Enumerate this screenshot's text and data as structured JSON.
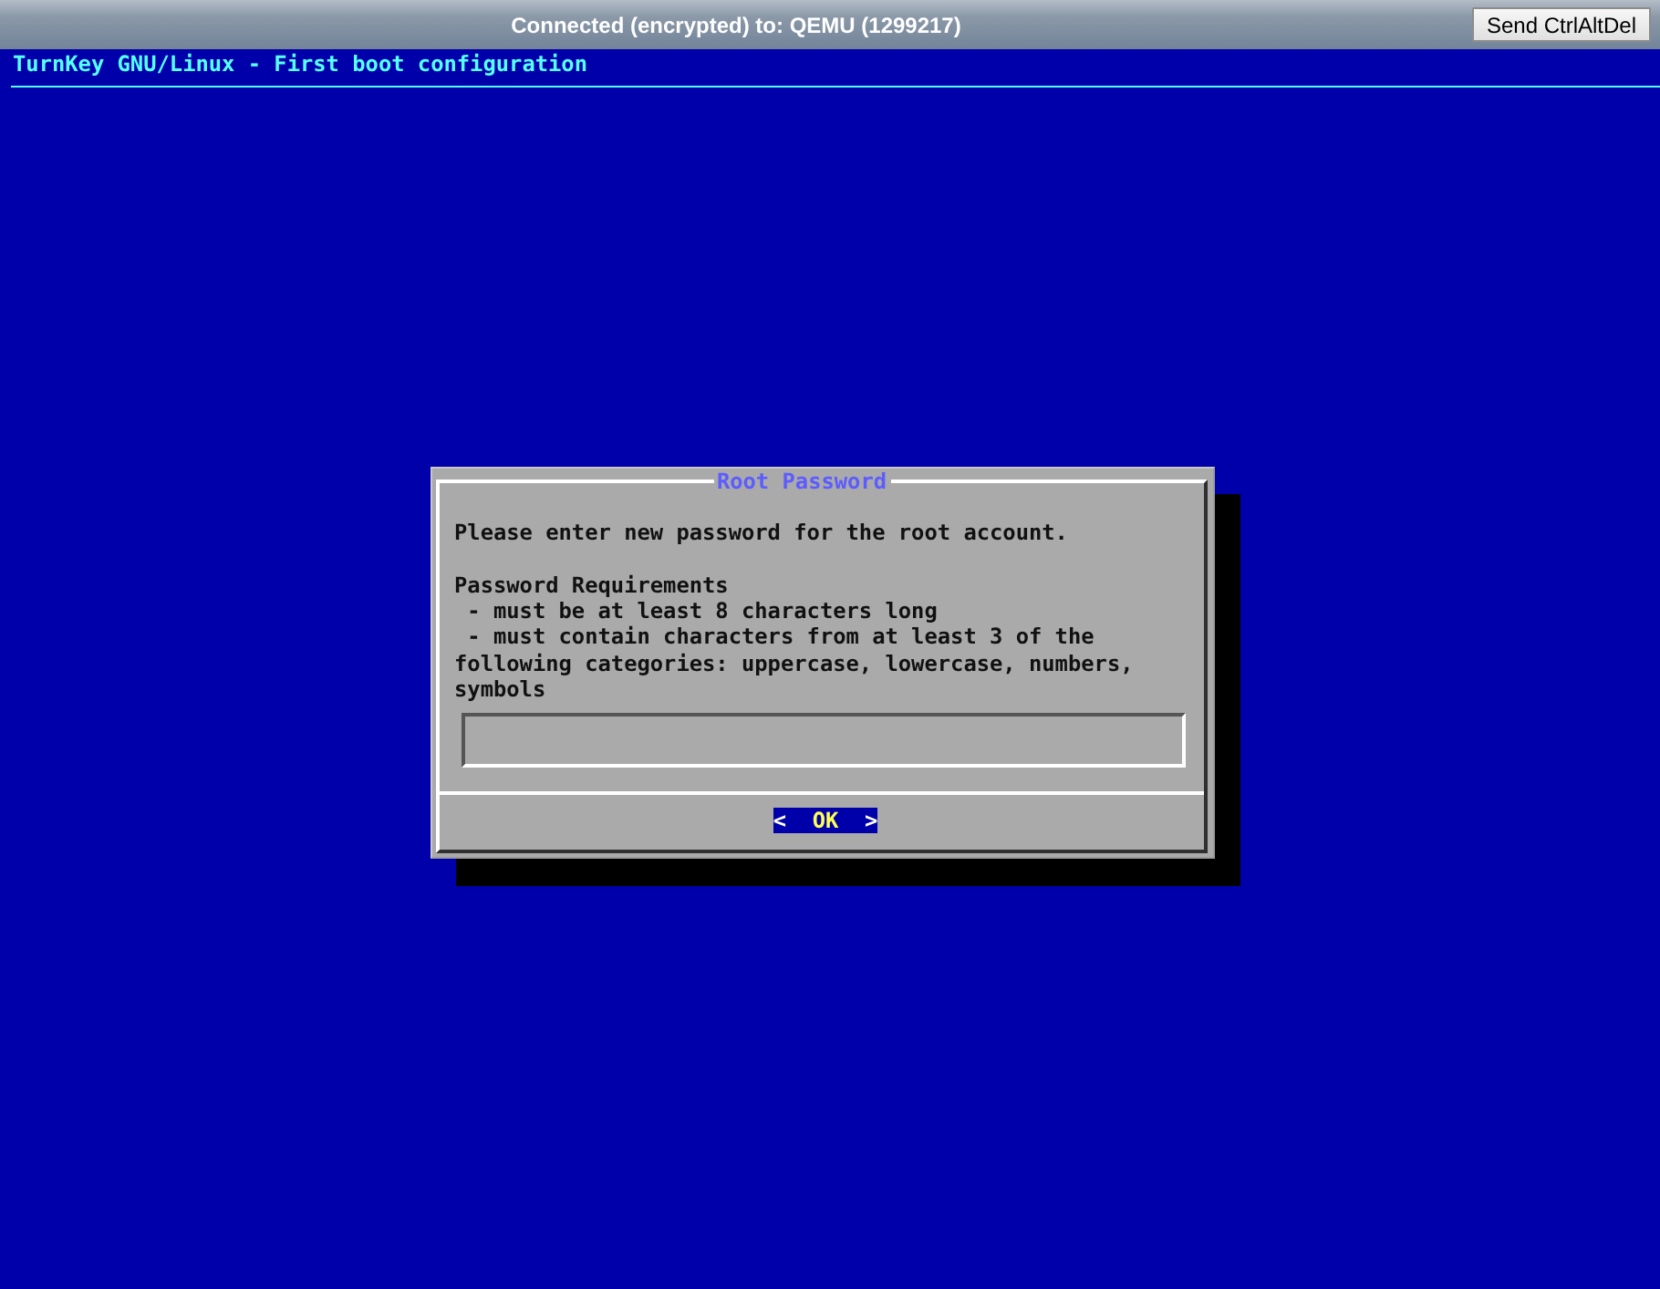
{
  "window": {
    "title": "Connected (encrypted) to: QEMU (1299217)",
    "button": "Send CtrlAltDel"
  },
  "console": {
    "title": "TurnKey GNU/Linux - First boot configuration"
  },
  "dialog": {
    "title": "Root Password",
    "message": "Please enter new password for the root account.",
    "requirements_heading": "Password Requirements",
    "requirements": [
      "- must be at least 8 characters long",
      "- must contain characters from at least 3 of the following categories: uppercase, lowercase, numbers, symbols"
    ],
    "buttons": [
      {
        "label": "OK",
        "left_mark": "<",
        "right_mark": ">",
        "selected": true
      }
    ]
  }
}
